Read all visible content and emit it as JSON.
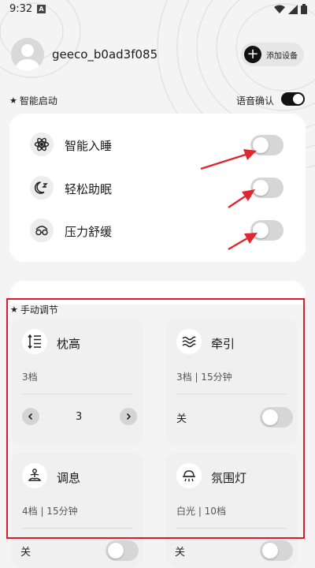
{
  "status_bar": {
    "time": "9:32",
    "notif_letter": "A"
  },
  "header": {
    "username": "geeco_b0ad3f085",
    "add_device_label": "添加设备"
  },
  "smart_start": {
    "title": "智能启动",
    "voice_confirm_label": "语音确认",
    "voice_confirm_on": true,
    "items": [
      {
        "label": "智能入睡",
        "icon": "atom-icon",
        "on": false
      },
      {
        "label": "轻松助眠",
        "icon": "moon-zz-icon",
        "on": false
      },
      {
        "label": "压力舒缓",
        "icon": "relax-glasses-icon",
        "on": false
      }
    ]
  },
  "manual": {
    "title": "手动调节",
    "cards": [
      {
        "name": "枕高",
        "icon": "pillow-height-icon",
        "sub": "3档",
        "stepper_value": "3"
      },
      {
        "name": "牵引",
        "icon": "traction-waves-icon",
        "sub": "3档 | 15分钟",
        "off_label": "关",
        "on": false
      },
      {
        "name": "调息",
        "icon": "meditation-icon",
        "sub": "4档 | 15分钟",
        "off_label": "关",
        "on": false
      },
      {
        "name": "氛围灯",
        "icon": "ambient-lamp-icon",
        "sub": "白光 | 10档",
        "off_label": "关",
        "on": false
      }
    ]
  },
  "colors": {
    "highlight_frame": "#d91e2a",
    "arrow": "#e0262f",
    "toggle_on": "#111111",
    "toggle_off": "#d6d6d6"
  }
}
